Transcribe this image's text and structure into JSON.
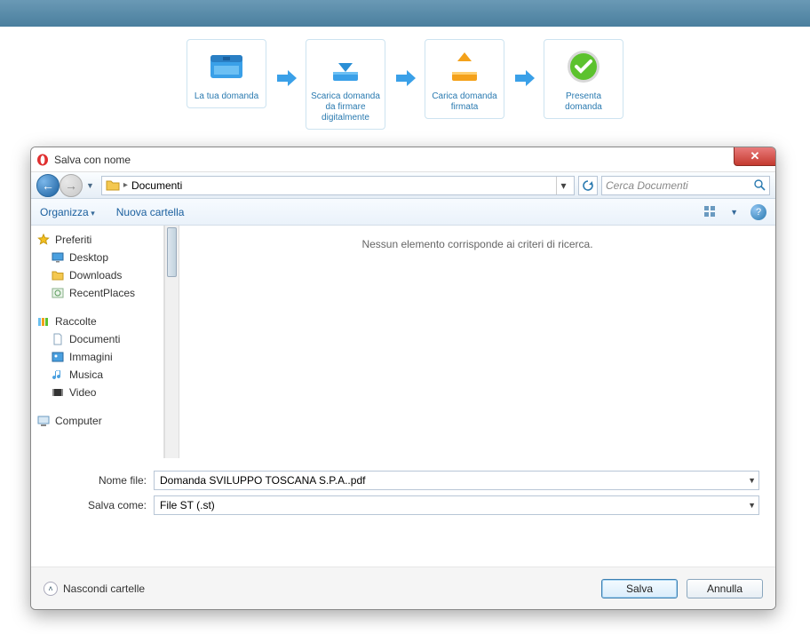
{
  "steps": [
    {
      "label": "La tua domanda"
    },
    {
      "label": "Scarica domanda da firmare digitalmente"
    },
    {
      "label": "Carica domanda firmata"
    },
    {
      "label": "Presenta domanda"
    }
  ],
  "dialog": {
    "title": "Salva con nome",
    "breadcrumb": "Documenti",
    "search_placeholder": "Cerca Documenti",
    "toolbar": {
      "organize": "Organizza",
      "new_folder": "Nuova cartella"
    },
    "tree": {
      "favorites": {
        "label": "Preferiti",
        "items": [
          "Desktop",
          "Downloads",
          "RecentPlaces"
        ]
      },
      "libraries": {
        "label": "Raccolte",
        "items": [
          "Documenti",
          "Immagini",
          "Musica",
          "Video"
        ]
      },
      "computer": {
        "label": "Computer"
      }
    },
    "content_empty": "Nessun elemento corrisponde ai criteri di ricerca.",
    "fields": {
      "name_label": "Nome file:",
      "name_value": "Domanda SVILUPPO TOSCANA S.P.A..pdf",
      "type_label": "Salva come:",
      "type_value": "File ST (.st)"
    },
    "footer": {
      "hide_folders": "Nascondi cartelle",
      "save": "Salva",
      "cancel": "Annulla"
    }
  }
}
